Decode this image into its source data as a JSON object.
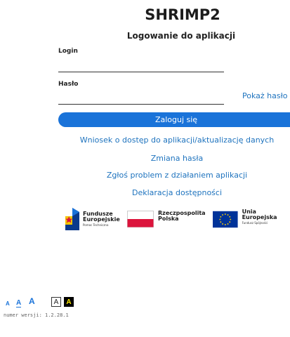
{
  "app": {
    "title": "SHRIMP2",
    "subtitle": "Logowanie do aplikacji"
  },
  "form": {
    "login_label": "Login",
    "login_value": "",
    "password_label": "Hasło",
    "password_value": "",
    "show_password": "Pokaż hasło",
    "submit": "Zaloguj się"
  },
  "links": {
    "access_request": "Wniosek o dostęp do aplikacji/aktualizację danych",
    "change_password": "Zmiana hasła",
    "report_problem": "Zgłoś problem z działaniem aplikacji",
    "accessibility": "Deklaracja dostępności"
  },
  "logos": {
    "fe_line1": "Fundusze",
    "fe_line2": "Europejskie",
    "fe_sub": "Pomoc Techniczna",
    "rp_line1": "Rzeczpospolita",
    "rp_line2": "Polska",
    "ue_line1": "Unia Europejska",
    "ue_sub": "Fundusz Spójności"
  },
  "accessibility_controls": {
    "font_small": "A",
    "font_medium": "A",
    "font_large": "A",
    "contrast_normal": "A",
    "contrast_high": "A"
  },
  "footer": {
    "version": "numer wersji: 1.2.28.1"
  },
  "colors": {
    "primary": "#1a73d9",
    "link": "#1e73be",
    "flag_red": "#dc143c",
    "eu_blue": "#003399",
    "eu_star": "#ffcc00"
  }
}
